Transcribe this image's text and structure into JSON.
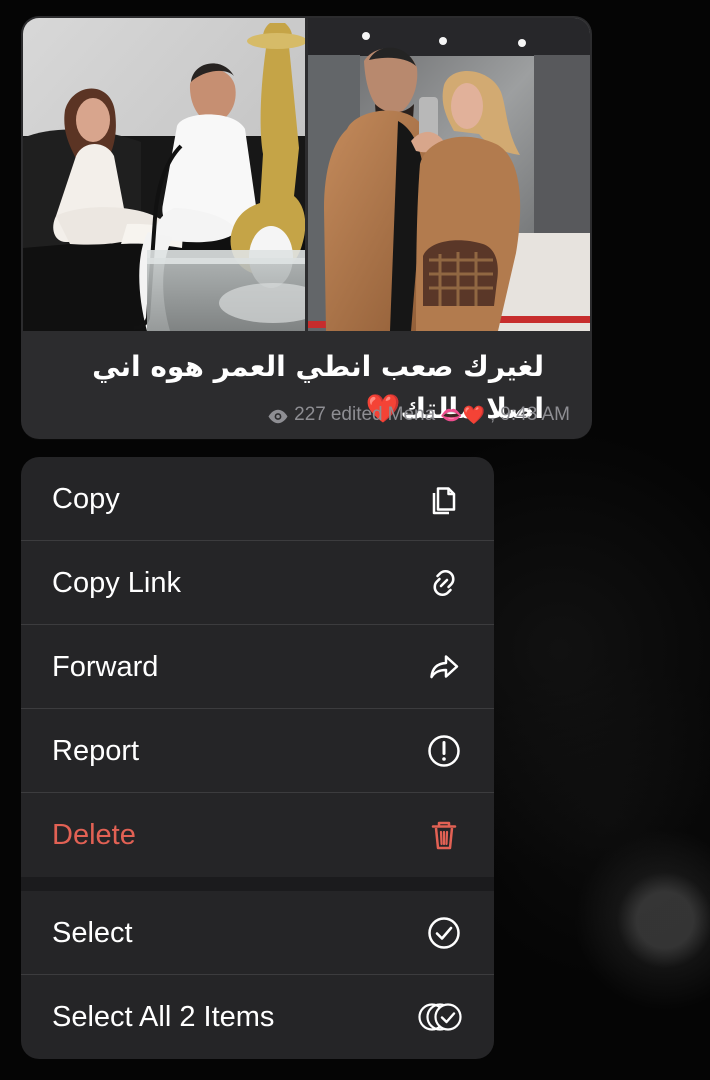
{
  "message": {
    "caption": "لغيرك صعب انطي العمر هوه اني اصلا مالتك❤️",
    "views": "227",
    "edited_label": "edited",
    "author": "Mena",
    "author_emojis": "👄❤️",
    "time": "9:43 AM"
  },
  "media": [
    {
      "name": "photo-couple-sofa"
    },
    {
      "name": "photo-couple-elevator"
    }
  ],
  "menu": {
    "items": [
      {
        "label": "Copy",
        "icon": "copy-icon"
      },
      {
        "label": "Copy Link",
        "icon": "link-icon"
      },
      {
        "label": "Forward",
        "icon": "forward-icon"
      },
      {
        "label": "Report",
        "icon": "report-icon"
      },
      {
        "label": "Delete",
        "icon": "trash-icon"
      },
      {
        "label": "Select",
        "icon": "check-circle-icon"
      },
      {
        "label": "Select All 2 Items",
        "icon": "multi-check-icon"
      }
    ]
  },
  "colors": {
    "bubble": "#2c2c2e",
    "menu_background": "#252527",
    "separator": "#1b1b1d",
    "danger": "#e26154",
    "muted_text": "#8e8e93",
    "text": "#ffffff"
  }
}
